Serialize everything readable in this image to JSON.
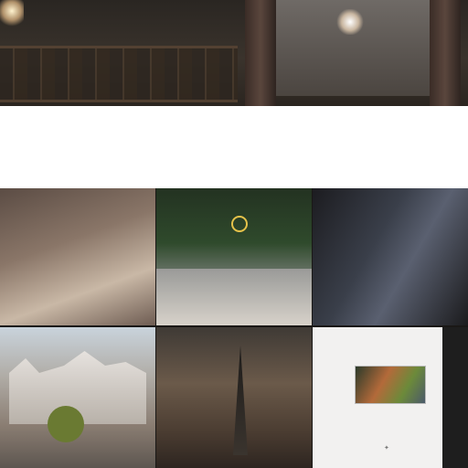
{
  "hero": {
    "title": "",
    "subtitle": ""
  },
  "intro": {
    "mark": "",
    "paragraph": ""
  },
  "tiles": [
    {
      "label": ""
    },
    {
      "label": "",
      "caption": ""
    },
    {
      "label": ""
    },
    {
      "caption": ""
    },
    {
      "label": "",
      "caption": ""
    },
    {
      "title": "",
      "caption": "",
      "pin_icon": "pin-icon"
    }
  ],
  "colors": {
    "accent": "#2ba3c6",
    "background": "#1a1816",
    "intro_bg": "#ffffff"
  }
}
